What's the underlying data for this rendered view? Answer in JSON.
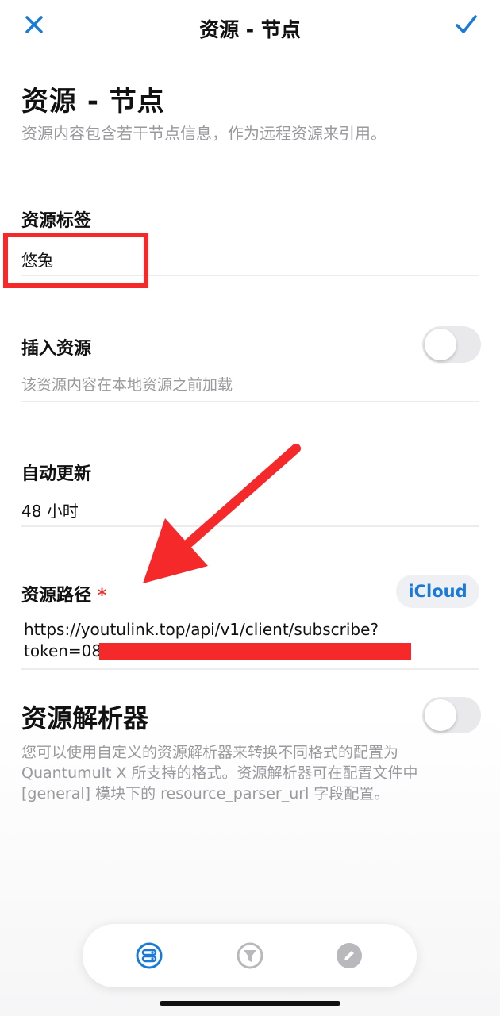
{
  "nav": {
    "title": "资源 - 节点",
    "close_icon": "close-icon",
    "confirm_icon": "checkmark-icon"
  },
  "header": {
    "title": "资源 - 节点",
    "subtitle": "资源内容包含若干节点信息，作为远程资源来引用。"
  },
  "tag": {
    "label": "资源标签",
    "value": "悠兔"
  },
  "insert": {
    "label": "插入资源",
    "hint": "该资源内容在本地资源之前加载",
    "enabled": false
  },
  "auto_update": {
    "label": "自动更新",
    "value": "48 小时"
  },
  "path": {
    "label": "资源路径",
    "required_mark": "*",
    "icloud_label": "iCloud",
    "url_line1": "https://youtulink.top/api/v1/client/subscribe?",
    "url_line2": "token=08"
  },
  "parser": {
    "label": "资源解析器",
    "enabled": false,
    "description": "您可以使用自定义的资源解析器来转换不同格式的配置为 Quantumult X 所支持的格式。资源解析器可在配置文件中 [general] 模块下的 resource_parser_url 字段配置。"
  },
  "tabbar": {
    "items": [
      "server-icon",
      "filter-icon",
      "edit-icon"
    ],
    "active_color": "#1a7ad9",
    "inactive_color": "#b9b9bd"
  },
  "colors": {
    "annotation_red": "#f5282a",
    "accent_blue": "#1a7ad9"
  }
}
